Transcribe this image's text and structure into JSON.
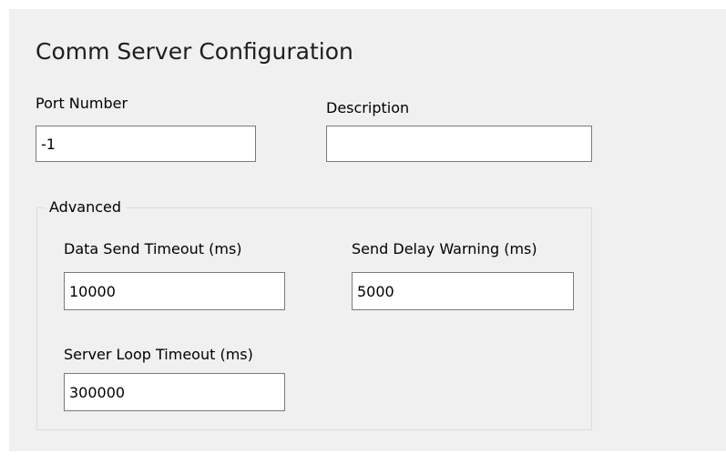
{
  "form": {
    "title": "Comm Server Configuration",
    "port_number": {
      "label": "Port Number",
      "value": "-1"
    },
    "description": {
      "label": "Description",
      "value": ""
    }
  },
  "advanced": {
    "legend": "Advanced",
    "data_send_timeout": {
      "label": "Data Send Timeout (ms)",
      "value": "10000"
    },
    "send_delay_warning": {
      "label": "Send Delay Warning (ms)",
      "value": "5000"
    },
    "server_loop_timeout": {
      "label": "Server Loop Timeout (ms)",
      "value": "300000"
    }
  }
}
